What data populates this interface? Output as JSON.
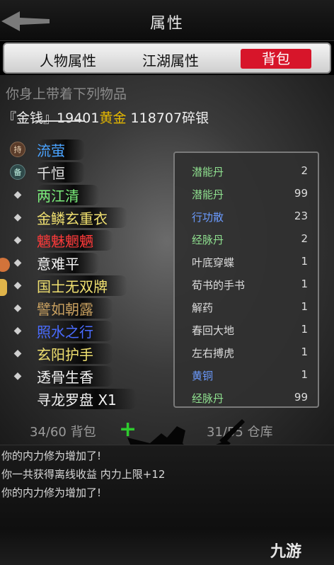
{
  "header": {
    "title": "属性"
  },
  "tabs": [
    {
      "label": "人物属性"
    },
    {
      "label": "江湖属性"
    },
    {
      "label": "背包"
    }
  ],
  "subtitle": "你身上带着下列物品",
  "money": {
    "label": "『金钱』",
    "gold_amount": "19401",
    "gold_label": "黄金",
    "silver_amount": "118707",
    "silver_label": "碎银"
  },
  "items": [
    {
      "badge": "持",
      "name": "流萤",
      "color": "#4aa3ff"
    },
    {
      "badge": "备",
      "name": "千恒",
      "color": "#e0e0e0"
    },
    {
      "name": "两江清",
      "color": "#7cf07c"
    },
    {
      "name": "金鳞玄重衣",
      "color": "#f0e070"
    },
    {
      "name": "魑魅魍魉",
      "color": "#ff3a3a"
    },
    {
      "name": "意难平",
      "color": "#f0f0f0"
    },
    {
      "name": "国士无双牌",
      "color": "#f0e070"
    },
    {
      "name": "譬如朝露",
      "color": "#c8a060"
    },
    {
      "name": "照水之行",
      "color": "#4a6cff"
    },
    {
      "name": "玄阳护手",
      "color": "#f0e070"
    },
    {
      "name": "透骨生香",
      "color": "#f0f0f0"
    },
    {
      "name": "寻龙罗盘 X1",
      "color": "#f0f0f0"
    }
  ],
  "storage": [
    {
      "name": "潜能丹",
      "qty": "2",
      "color": "#8fe08f"
    },
    {
      "name": "潜能丹",
      "qty": "99",
      "color": "#8fe08f"
    },
    {
      "name": "行功散",
      "qty": "23",
      "color": "#6b9bff"
    },
    {
      "name": "经脉丹",
      "qty": "2",
      "color": "#8fe08f"
    },
    {
      "name": "叶底穿蝶",
      "qty": "1",
      "color": "#dddddd"
    },
    {
      "name": "荀书的手书",
      "qty": "1",
      "color": "#dddddd"
    },
    {
      "name": "解药",
      "qty": "1",
      "color": "#dddddd"
    },
    {
      "name": "春回大地",
      "qty": "1",
      "color": "#dddddd"
    },
    {
      "name": "左右搏虎",
      "qty": "1",
      "color": "#dddddd"
    },
    {
      "name": "黄铜",
      "qty": "1",
      "color": "#6b9bff"
    },
    {
      "name": "经脉丹",
      "qty": "99",
      "color": "#8fe08f"
    }
  ],
  "bag": {
    "count": "34/60 背包",
    "add_label": "+"
  },
  "warehouse": {
    "count": "31/55 仓库"
  },
  "log": [
    "你的内力修为增加了!",
    "你一共获得离线收益 内力上限+12",
    "你的内力修为增加了!"
  ],
  "watermark": "九游"
}
